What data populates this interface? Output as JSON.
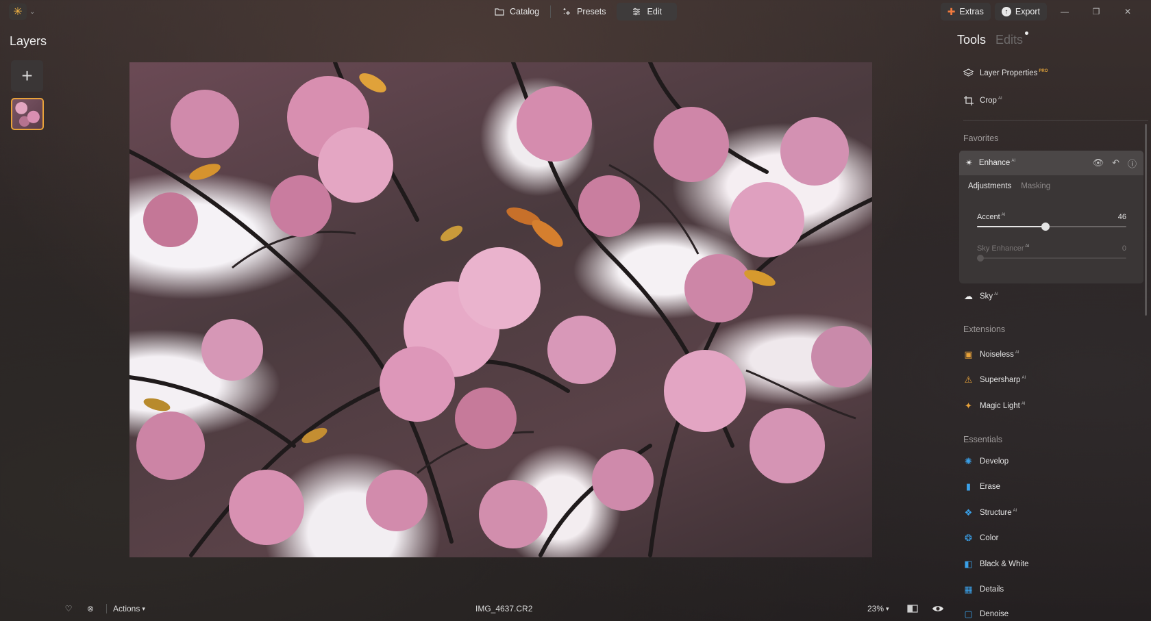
{
  "app": {
    "menu_caret": "⌄"
  },
  "nav": {
    "catalog": "Catalog",
    "presets": "Presets",
    "edit": "Edit"
  },
  "top_right": {
    "extras": "Extras",
    "export": "Export"
  },
  "layers": {
    "title": "Layers",
    "add_symbol": "+"
  },
  "photo": {
    "filename": "IMG_4637.CR2"
  },
  "bottom": {
    "actions": "Actions",
    "zoom": "23%"
  },
  "panel": {
    "tabs": {
      "tools": "Tools",
      "edits": "Edits"
    },
    "top_tools": [
      {
        "label": "Layer Properties",
        "badge": "PRO"
      },
      {
        "label": "Crop",
        "badge": "AI"
      }
    ],
    "favorites_label": "Favorites",
    "enhance": {
      "label": "Enhance",
      "badge": "AI",
      "tab_adjustments": "Adjustments",
      "tab_masking": "Masking",
      "sliders": [
        {
          "label": "Accent",
          "badge": "AI",
          "value": "46",
          "level": 0.46
        },
        {
          "label": "Sky Enhancer",
          "badge": "AI",
          "value": "0",
          "level": 0
        }
      ]
    },
    "sky": {
      "label": "Sky",
      "badge": "AI"
    },
    "extensions_label": "Extensions",
    "extensions": [
      {
        "label": "Noiseless",
        "badge": "AI"
      },
      {
        "label": "Supersharp",
        "badge": "AI"
      },
      {
        "label": "Magic Light",
        "badge": "AI"
      }
    ],
    "essentials_label": "Essentials",
    "essentials": [
      {
        "label": "Develop"
      },
      {
        "label": "Erase"
      },
      {
        "label": "Structure",
        "badge": "AI"
      },
      {
        "label": "Color"
      },
      {
        "label": "Black & White"
      },
      {
        "label": "Details"
      },
      {
        "label": "Denoise"
      }
    ]
  },
  "colors": {
    "accent_orange": "#e8a23a",
    "extras_orange": "#f07a3e",
    "icon_blue": "#3aa0e8"
  }
}
